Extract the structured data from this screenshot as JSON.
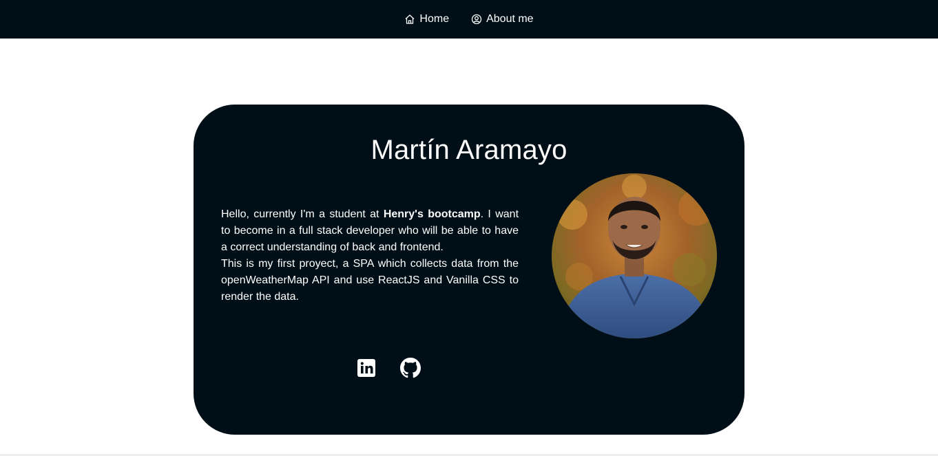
{
  "nav": {
    "home_label": "Home",
    "home_icon": "home-icon",
    "about_label": "About me",
    "about_icon": "user-circle-icon"
  },
  "profile": {
    "name": "Martín Aramayo",
    "bio_intro": "Hello, currently I'm a student at ",
    "bio_highlight": "Henry's bootcamp",
    "bio_rest": ". I want to become in a full stack developer who will be able to have a correct understanding of back and frontend.",
    "bio_project": "This is my first proyect, a SPA which collects data from the openWeatherMap API and use ReactJS and Vanilla CSS to render the data."
  },
  "social": {
    "linkedin_icon": "linkedin-icon",
    "github_icon": "github-icon"
  },
  "colors": {
    "nav_background": "#000f17",
    "card_background": "#000f17",
    "text": "#ffffff",
    "page_background": "#ffffff"
  }
}
